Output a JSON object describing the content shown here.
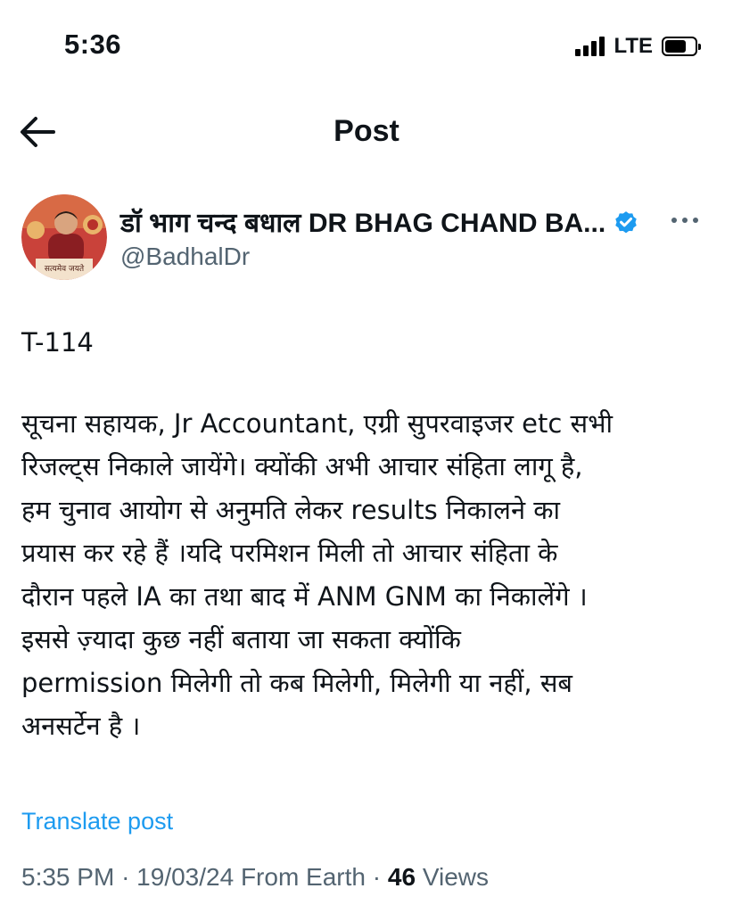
{
  "status_bar": {
    "time": "5:36",
    "network": "LTE",
    "icons": [
      "signal-icon",
      "battery-icon"
    ]
  },
  "header": {
    "title": "Post",
    "back_icon": "back-arrow-icon"
  },
  "post": {
    "author": {
      "display_name": "डॉ भाग चन्द बधाल DR BHAG CHAND BA...",
      "handle": "@BadhalDr",
      "verified": true,
      "avatar_caption": "सत्यमेव जयते",
      "verified_color": "#1d9bf0"
    },
    "more_icon": "more-icon",
    "body_lines": [
      "T-114",
      "सूचना सहायक, Jr Accountant, एग्री सुपरवाइजर etc सभी",
      "रिजल्ट्स निकाले जायेंगे। क्योंकी अभी आचार संहिता लागू है,",
      "हम चुनाव आयोग से अनुमति लेकर results निकालने का",
      "प्रयास कर रहे हैं ।यदि परमिशन मिली तो आचार संहिता के",
      "दौरान पहले IA का तथा बाद में ANM GNM का निकालेंगे ।",
      "इससे ज़्यादा कुछ नहीं बताया जा सकता क्योंकि",
      "permission मिलेगी तो कब मिलेगी, मिलेगी या नहीं, सब",
      "अनसर्टेन है ।"
    ],
    "translate_label": "Translate post",
    "meta": {
      "time": "5:35 PM",
      "separator": "·",
      "date": "19/03/24",
      "source": "From Earth",
      "views_count": "46",
      "views_label": "Views"
    }
  },
  "colors": {
    "text": "#0f1419",
    "secondary": "#536471",
    "accent": "#1d9bf0"
  }
}
